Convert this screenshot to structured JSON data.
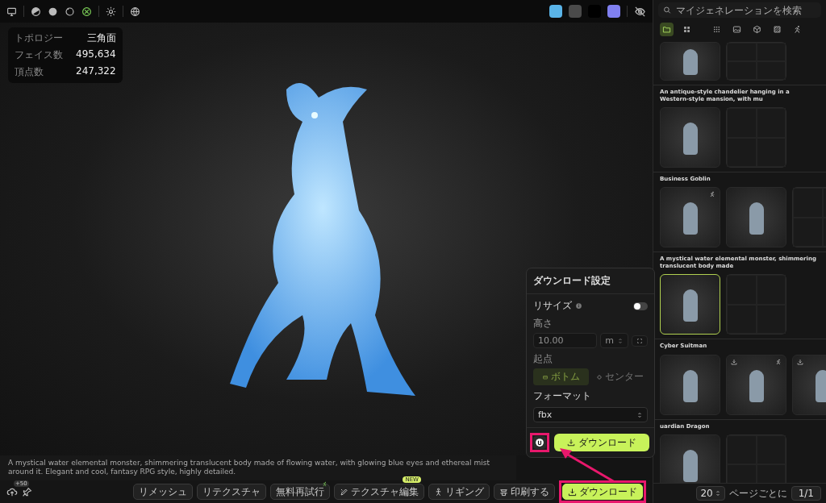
{
  "viewport": {
    "shading_modes": [
      {
        "selected": false
      },
      {
        "selected": false
      },
      {
        "selected": false
      },
      {
        "selected": true
      }
    ],
    "swatches": [
      {
        "color": "#5ab4e8"
      },
      {
        "color": "#4a4a4a"
      },
      {
        "color": "#000000"
      },
      {
        "color": "#8080f0"
      }
    ],
    "stats": [
      {
        "label": "トポロジー",
        "value": "三角面"
      },
      {
        "label": "フェイス数",
        "value": "495,634"
      },
      {
        "label": "頂点数",
        "value": "247,322"
      }
    ],
    "prompt": "A mystical water elemental monster, shimmering translucent body made of flowing water, with glowing blue eyes and ethereal mist around it. Elegant and cool, fantasy RPG style, highly detailed."
  },
  "bottom_bar": {
    "credits_badge": "+50",
    "actions": [
      {
        "label": "リメッシュ",
        "kind": "plain",
        "highlighted": false
      },
      {
        "label": "リテクスチャ",
        "kind": "plain",
        "highlighted": false
      },
      {
        "label": "無料再試行",
        "kind": "plain",
        "corner_mark": true,
        "highlighted": false
      },
      {
        "label": "テクスチャ編集",
        "kind": "icon",
        "badge": "NEW",
        "highlighted": false
      },
      {
        "label": "リギング",
        "kind": "icon",
        "highlighted": false
      },
      {
        "label": "印刷する",
        "kind": "icon",
        "highlighted": false
      },
      {
        "label": "ダウンロード",
        "kind": "primary",
        "highlighted": true
      }
    ]
  },
  "sidebar": {
    "search": {
      "placeholder": "マイジェネレーションを検索"
    },
    "filters": [
      {
        "selected": true
      },
      {
        "selected": false
      },
      {
        "selected": false
      },
      {
        "selected": false
      },
      {
        "selected": false
      },
      {
        "selected": false
      },
      {
        "selected": false
      }
    ],
    "groups": [
      {
        "thumbs": [
          {
            "kind": "render",
            "selected": false
          },
          {
            "kind": "views",
            "selected": false
          }
        ]
      },
      {
        "title": "An antique-style chandelier hanging in a Western-style mansion, with mu",
        "thumbs": [
          {
            "kind": "render",
            "selected": false
          },
          {
            "kind": "views",
            "selected": false
          }
        ]
      },
      {
        "title": "Business Goblin",
        "thumbs": [
          {
            "kind": "render",
            "selected": false,
            "rigged": true
          },
          {
            "kind": "render",
            "selected": false
          },
          {
            "kind": "views",
            "selected": false
          }
        ]
      },
      {
        "title": "A mystical water elemental monster, shimmering translucent body made",
        "thumbs": [
          {
            "kind": "render",
            "selected": true
          },
          {
            "kind": "views",
            "selected": false
          }
        ]
      },
      {
        "title": "Cyber Suitman",
        "thumbs": [
          {
            "kind": "render",
            "selected": false
          },
          {
            "kind": "render",
            "selected": false,
            "downloaded": true,
            "rigged": true
          },
          {
            "kind": "render",
            "selected": false,
            "downloaded": true
          }
        ]
      },
      {
        "title": "uardian Dragon",
        "thumbs": [
          {
            "kind": "render",
            "selected": false
          },
          {
            "kind": "views",
            "selected": false
          }
        ]
      }
    ],
    "pager": {
      "page_size": "20",
      "page_size_label": "ページごとに",
      "page": "1/1"
    }
  },
  "download_panel": {
    "title": "ダウンロード設定",
    "resize": {
      "label": "リサイズ",
      "on": false
    },
    "height": {
      "label": "高さ",
      "value": "10.00",
      "unit": "m",
      "disabled": true
    },
    "origin": {
      "label": "起点",
      "disabled": true,
      "options": [
        {
          "label": "ボトム",
          "selected": true
        },
        {
          "label": "センター",
          "selected": false
        }
      ]
    },
    "format": {
      "label": "フォーマット",
      "value": "fbx"
    },
    "engine_button": {
      "highlighted": true
    },
    "download_button": {
      "label": "ダウンロード"
    }
  }
}
